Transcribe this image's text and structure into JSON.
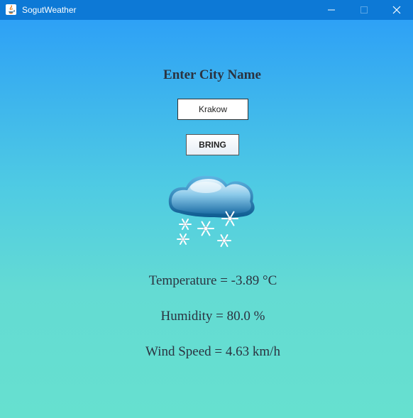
{
  "window": {
    "title": "SogutWeather"
  },
  "form": {
    "heading": "Enter City Name",
    "city_value": "Krakow",
    "bring_label": "BRING"
  },
  "weather": {
    "icon": "snow-cloud-icon",
    "temperature_text": "Temperature = -3.89 °C",
    "humidity_text": "Humidity = 80.0 %",
    "wind_text": "Wind Speed = 4.63 km/h"
  },
  "colors": {
    "titlebar": "#0d79d6",
    "gradient_top": "#2a9cf8",
    "gradient_bottom": "#66e0cf",
    "text": "#2b3340"
  }
}
